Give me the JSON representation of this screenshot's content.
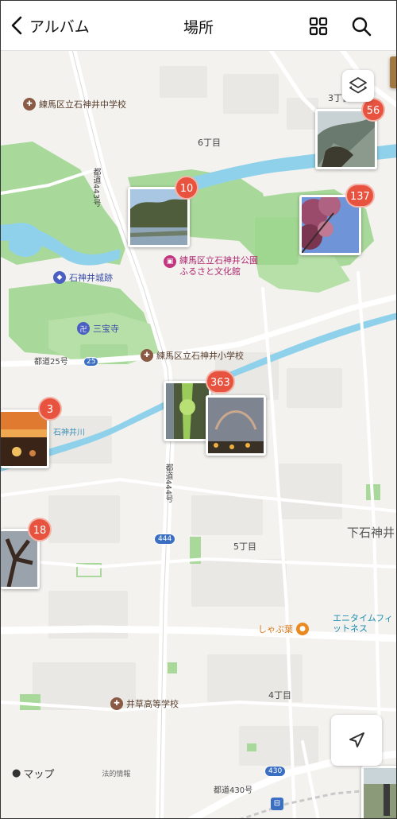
{
  "header": {
    "back_label": "アルバム",
    "title": "場所"
  },
  "map": {
    "district_labels": [
      {
        "id": "6chome",
        "text": "6丁目"
      },
      {
        "id": "5chome",
        "text": "5丁目"
      },
      {
        "id": "4chome",
        "text": "4丁目"
      },
      {
        "id": "3chome",
        "text": "3丁目"
      },
      {
        "id": "shimo-shakujii",
        "text": "下石神井"
      }
    ],
    "pois": [
      {
        "id": "junior-high",
        "text": "練馬区立石神井中学校",
        "color": "#8a5a44"
      },
      {
        "id": "furusato",
        "text": "練馬区立石神井公園ふるさと文化館",
        "color": "#c2357f"
      },
      {
        "id": "castle",
        "text": "石神井城跡",
        "color": "#4a5fc1"
      },
      {
        "id": "sanpoji",
        "text": "三宝寺",
        "color": "#4a5fc1"
      },
      {
        "id": "elementary",
        "text": "練馬区立石神井小学校",
        "color": "#8a5a44"
      },
      {
        "id": "highschool",
        "text": "井草高等学校",
        "color": "#8a5a44"
      },
      {
        "id": "shabuyo",
        "text": "しゃぶ葉",
        "color": "#e9891f"
      },
      {
        "id": "anytime",
        "text": "エニタイムフィットネス",
        "color": "#27a3c6"
      }
    ],
    "road_labels": [
      {
        "id": "road25",
        "text": "都道25号"
      },
      {
        "id": "road25-badge",
        "text": "25"
      },
      {
        "id": "road444-vertical",
        "text": "都道444号"
      },
      {
        "id": "road444-badge",
        "text": "444"
      },
      {
        "id": "road430",
        "text": "都道430号"
      },
      {
        "id": "road430-badge",
        "text": "430"
      },
      {
        "id": "river",
        "text": "石神井川"
      },
      {
        "id": "road-vertical-top",
        "text": "都道443号"
      }
    ],
    "attribution": "マップ",
    "attribution_legal": "法的情報"
  },
  "clusters": [
    {
      "id": "cluster-56",
      "count": "56"
    },
    {
      "id": "cluster-10",
      "count": "10"
    },
    {
      "id": "cluster-137",
      "count": "137"
    },
    {
      "id": "cluster-363",
      "count": "363"
    },
    {
      "id": "cluster-3",
      "count": "3"
    },
    {
      "id": "cluster-18",
      "count": "18"
    }
  ],
  "colors": {
    "badge": "#e8533f",
    "park": "#a8d99a",
    "water": "#8fd1ea",
    "road": "#ffffff",
    "land": "#f3f2ef"
  },
  "icons": {
    "back": "chevron-left-icon",
    "grid": "grid-icon",
    "search": "search-icon",
    "layers": "layers-icon",
    "location": "location-arrow-icon"
  }
}
